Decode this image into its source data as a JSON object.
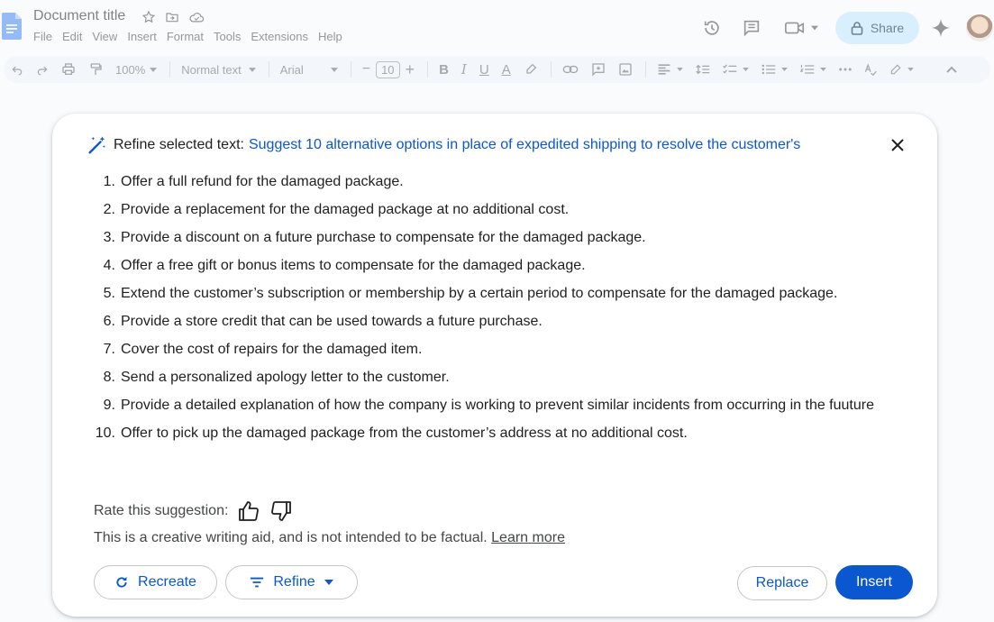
{
  "header": {
    "title": "Document title",
    "menu": [
      "File",
      "Edit",
      "View",
      "Insert",
      "Format",
      "Tools",
      "Extensions",
      "Help"
    ],
    "share_label": "Share",
    "icons": [
      "star-icon",
      "move-folder-icon",
      "cloud-status-icon",
      "history-icon",
      "comments-icon",
      "meet-icon",
      "gemini-sparkle-icon"
    ]
  },
  "toolbar": {
    "zoom": "100%",
    "style": "Normal text",
    "font": "Arial",
    "font_size": "10",
    "minus": "−",
    "plus": "+",
    "bold": "B",
    "italic": "I",
    "underline": "U",
    "text_color": "A"
  },
  "dialog": {
    "label": "Refine selected text:",
    "prompt": "Suggest 10 alternative options in place of expedited shipping to resolve the customer's",
    "items": [
      {
        "num": "1.",
        "text": "Offer a full refund for the damaged package."
      },
      {
        "num": "2.",
        "text": "Provide a replacement for the damaged package at no additional cost."
      },
      {
        "num": "3.",
        "text": "Provide a discount on a future purchase to compensate for the damaged package."
      },
      {
        "num": "4.",
        "text": "Offer a free gift or bonus items to compensate for the damaged package."
      },
      {
        "num": "5.",
        "text": "Extend the customer’s subscription or membership by a certain period to compensate for the damaged package."
      },
      {
        "num": "6.",
        "text": "Provide a store credit that can be used towards a future purchase."
      },
      {
        "num": "7.",
        "text": "Cover the cost of repairs for the damaged item."
      },
      {
        "num": "8.",
        "text": "Send a personalized apology letter to the customer."
      },
      {
        "num": "9.",
        "text": "Provide a detailed explanation of how the company is working to prevent similar incidents from occurring in the fuuture"
      },
      {
        "num": "10.",
        "text": "Offer to pick up the damaged package from the customer’s address at no additional cost."
      }
    ],
    "rate_label": "Rate this suggestion:",
    "disclaimer": "This is a creative writing aid, and is not intended to be factual.",
    "learn_more": "Learn more",
    "recreate_label": "Recreate",
    "refine_label": "Refine",
    "replace_label": "Replace",
    "insert_label": "Insert"
  },
  "colors": {
    "accent": "#0b57d0",
    "share_bg": "#c2e7ff",
    "toolbar_bg": "#edf2fa"
  }
}
